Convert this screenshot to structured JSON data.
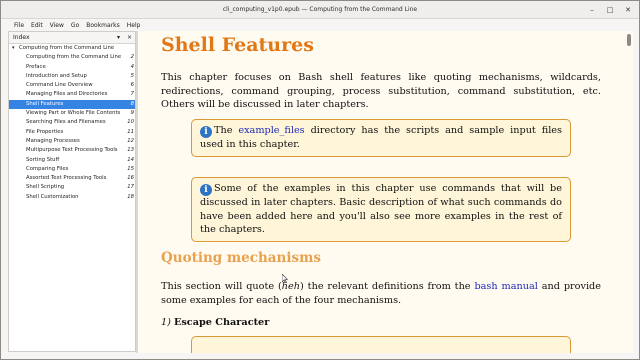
{
  "window": {
    "title": "cli_computing_v1p0.epub — Computing from the Command Line",
    "minimize": "–",
    "maximize": "□",
    "close": "✕"
  },
  "menu": [
    "File",
    "Edit",
    "View",
    "Go",
    "Bookmarks",
    "Help"
  ],
  "sidebar": {
    "header": "Index",
    "header_btn_1": "▾",
    "header_btn_2": "×",
    "items": [
      {
        "label": "Computing from the Command Line",
        "page": "",
        "root": true
      },
      {
        "label": "Computing from the Command Line",
        "page": "2"
      },
      {
        "label": "Preface",
        "page": "4"
      },
      {
        "label": "Introduction and Setup",
        "page": "5"
      },
      {
        "label": "Command Line Overview",
        "page": "6"
      },
      {
        "label": "Managing Files and Directories",
        "page": "7"
      },
      {
        "label": "Shell Features",
        "page": "8",
        "selected": true
      },
      {
        "label": "Viewing Part or Whole File Contents",
        "page": "9"
      },
      {
        "label": "Searching Files and Filenames",
        "page": "10"
      },
      {
        "label": "File Properties",
        "page": "11"
      },
      {
        "label": "Managing Processes",
        "page": "12"
      },
      {
        "label": "Multipurpose Text Processing Tools",
        "page": "13"
      },
      {
        "label": "Sorting Stuff",
        "page": "14"
      },
      {
        "label": "Comparing Files",
        "page": "15"
      },
      {
        "label": "Assorted Text Processing Tools",
        "page": "16"
      },
      {
        "label": "Shell Scripting",
        "page": "17"
      },
      {
        "label": "Shell Customization",
        "page": "18"
      }
    ]
  },
  "content": {
    "heading": "Shell Features",
    "intro": "This chapter focuses on Bash shell features like quoting mechanisms, wildcards, redirections, command grouping, process substitution, command substitution, etc. Others will be discussed in later chapters.",
    "note1_pre": "The ",
    "note1_link": "example_files",
    "note1_post": " directory has the scripts and sample input files used in this chapter.",
    "note2": "Some of the examples in this chapter use commands that will be discussed in later chapters. Basic description of what such commands do have been added here and you'll also see more examples in the rest of the chapters.",
    "section_heading": "Quoting mechanisms",
    "section_p_pre": "This section will quote (",
    "section_p_heh": "heh",
    "section_p_mid": ") the relevant definitions from the ",
    "section_p_link": "bash manual",
    "section_p_post": " and provide some examples for each of the four mechanisms.",
    "sub_num": "1)",
    "sub_title": "Escape Character"
  },
  "colors": {
    "heading": "#e07818",
    "section_heading": "#e8a14e",
    "note_bg": "#fff5d9",
    "note_border": "#d99a35",
    "link": "#1d2ab8",
    "selection": "#3584e4"
  }
}
